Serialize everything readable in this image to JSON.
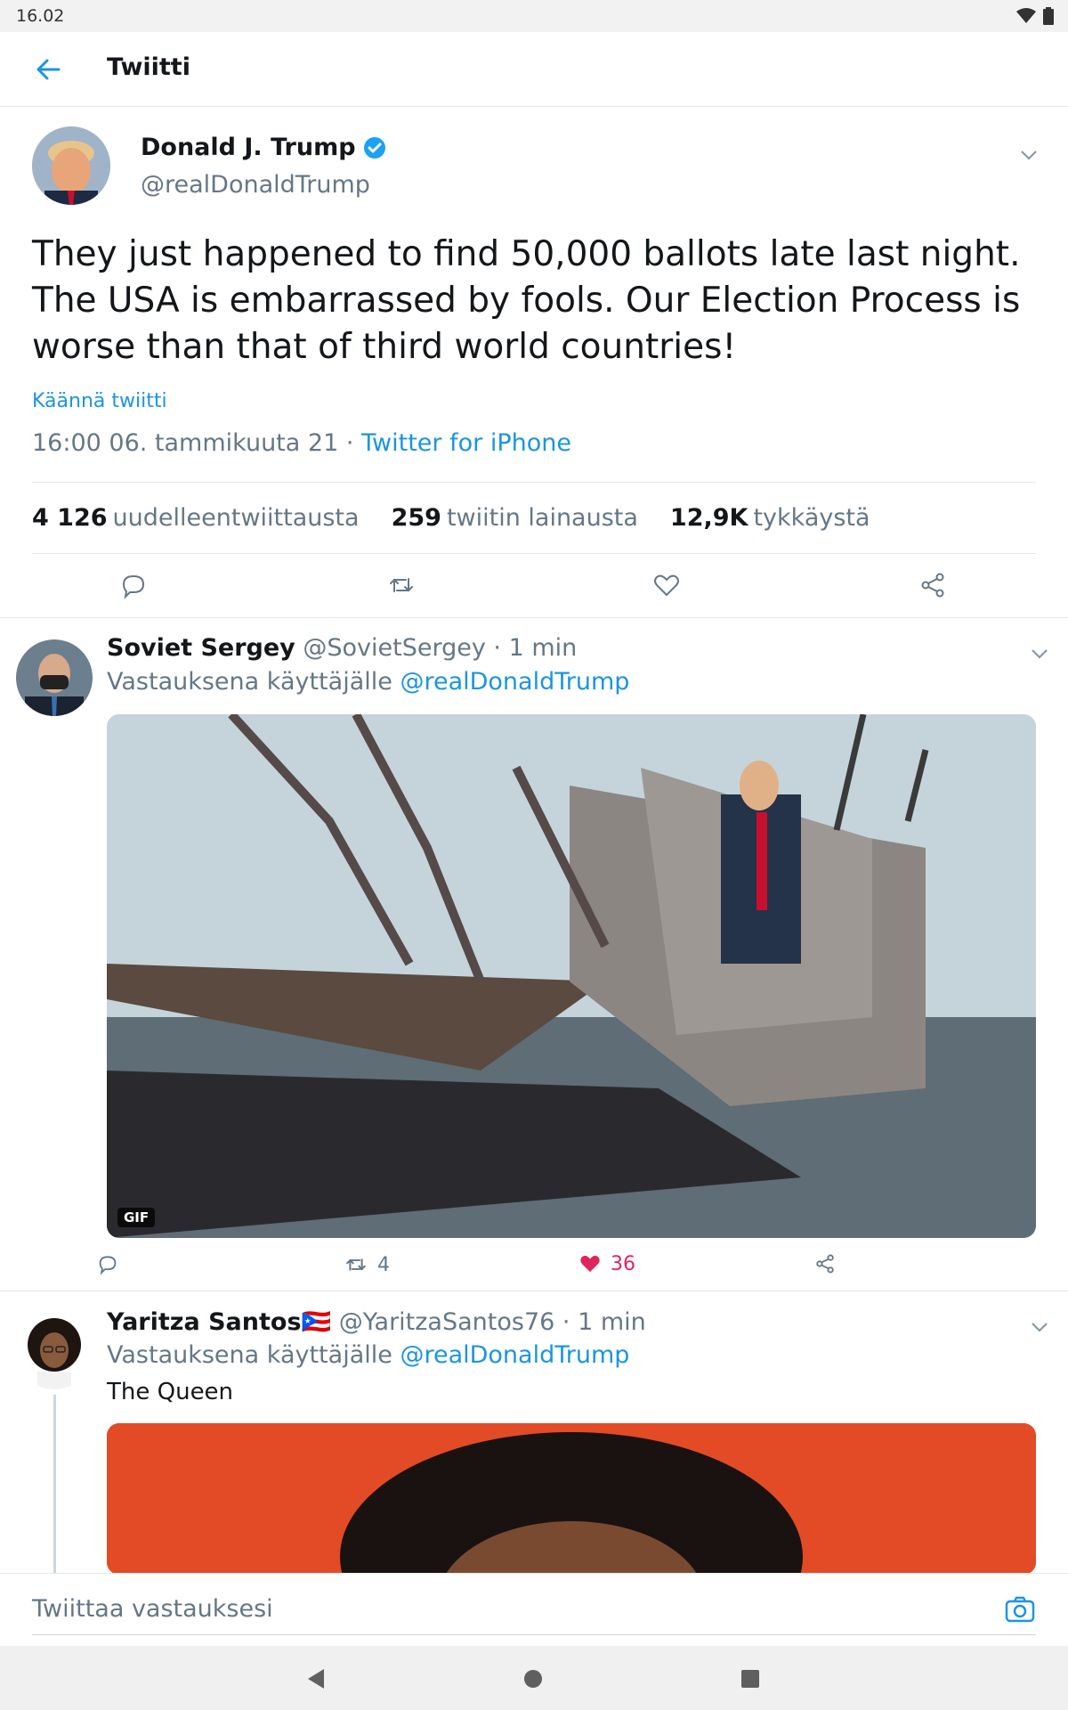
{
  "status_bar": {
    "time": "16.02"
  },
  "app_bar": {
    "title": "Twiitti"
  },
  "main_tweet": {
    "author_name": "Donald J. Trump",
    "author_handle": "@realDonaldTrump",
    "verified": true,
    "text": "They just happened to find 50,000 ballots late last night. The USA is embarrassed by fools. Our Election Process is worse than that of third world countries!",
    "translate_label": "Käännä twiitti",
    "timestamp": "16:00 06. tammikuuta 21",
    "separator": "·",
    "source": "Twitter for iPhone",
    "stats": {
      "retweets_count": "4 126",
      "retweets_label": "uudelleentwiittausta",
      "quotes_count": "259",
      "quotes_label": "twiitin lainausta",
      "likes_count": "12,9K",
      "likes_label": "tykkäystä"
    }
  },
  "replies": [
    {
      "name": "Soviet Sergey",
      "handle": "@SovietSergey",
      "time": "· 1 min",
      "replying_prefix": "Vastauksena käyttäjälle",
      "replying_to": "@realDonaldTrump",
      "media_badge": "GIF",
      "retweets": "4",
      "likes": "36"
    },
    {
      "name": "Yaritza Santos",
      "flag": "🇵🇷",
      "handle": "@YaritzaSantos76",
      "time": "· 1 min",
      "replying_prefix": "Vastauksena käyttäjälle",
      "replying_to": "@realDonaldTrump",
      "text": "The Queen"
    }
  ],
  "composer": {
    "placeholder": "Twiittaa vastauksesi"
  },
  "colors": {
    "accent": "#1b95e0",
    "like": "#e0245e",
    "muted": "#657786",
    "text": "#14171a"
  },
  "icons": [
    "back-arrow-icon",
    "verified-icon",
    "chevron-down-icon",
    "reply-icon",
    "retweet-icon",
    "like-icon",
    "share-icon",
    "camera-icon",
    "wifi-icon",
    "battery-icon",
    "nav-back-icon",
    "nav-home-icon",
    "nav-recents-icon"
  ]
}
